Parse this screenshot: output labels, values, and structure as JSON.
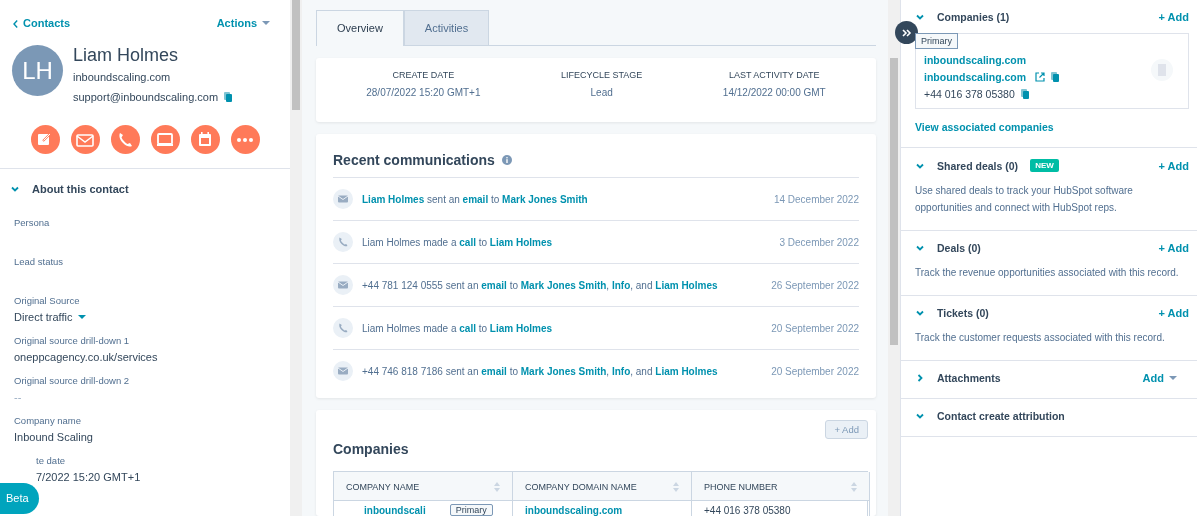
{
  "header": {
    "back_link": "Contacts",
    "actions": "Actions"
  },
  "contact": {
    "initials": "LH",
    "name": "Liam Holmes",
    "domain": "inboundscaling.com",
    "email": "support@inboundscaling.com"
  },
  "quick_actions": [
    {
      "kind": "note"
    },
    {
      "kind": "email"
    },
    {
      "kind": "call"
    },
    {
      "kind": "screen"
    },
    {
      "kind": "calendar"
    },
    {
      "kind": "more"
    }
  ],
  "about": {
    "title": "About this contact",
    "expanded": true
  },
  "fields": [
    {
      "label": "Persona"
    },
    {
      "label": "Lead status"
    },
    {
      "label": "Original Source",
      "value": "Direct traffic",
      "kind": "dropdown"
    },
    {
      "label": "Original source drill-down 1",
      "value": "oneppcagency.co.uk/services",
      "kind": "text"
    },
    {
      "label": "Original source drill-down 2",
      "value": "--",
      "kind": "empty"
    },
    {
      "label": "Company name",
      "value": "Inbound Scaling",
      "kind": "text"
    },
    {
      "label": "te date",
      "value": "7/2022 15:20 GMT+1",
      "kind": "text"
    }
  ],
  "beta_button": "Beta",
  "tabs": [
    {
      "label": "Overview",
      "selected": true
    },
    {
      "label": "Activities",
      "selected": false
    }
  ],
  "summary": [
    {
      "label": "CREATE DATE",
      "value": "28/07/2022 15:20 GMT+1"
    },
    {
      "label": "LIFECYCLE STAGE",
      "value": "Lead"
    },
    {
      "label": "LAST ACTIVITY DATE",
      "value": "14/12/2022 00:00 GMT"
    }
  ],
  "recent": {
    "title": "Recent communications",
    "items": [
      {
        "kind": "email",
        "text": "**Liam Holmes** sent an **email** to **Mark Jones Smith**",
        "date": "14 December 2022"
      },
      {
        "kind": "call",
        "text": "Liam Holmes made a **call** to **Liam Holmes**",
        "date": "3 December 2022"
      },
      {
        "kind": "email",
        "text": "+44 781 124 0555 sent an **email** to **Mark Jones Smith**, **Info**, and **Liam Holmes**",
        "date": "26 September 2022"
      },
      {
        "kind": "call",
        "text": "Liam Holmes made a **call** to **Liam Holmes**",
        "date": "20 September 2022"
      },
      {
        "kind": "email",
        "text": "+44 746 818 7186 sent an **email** to **Mark Jones Smith**, **Info**, and **Liam Holmes**",
        "date": "20 September 2022"
      }
    ]
  },
  "companies": {
    "title": "Companies",
    "add": "+ Add",
    "columns": [
      "COMPANY NAME",
      "COMPANY DOMAIN NAME",
      "PHONE NUMBER"
    ],
    "rows": [
      {
        "name": "inboundscali",
        "badge": "Primary",
        "domain": "inboundscaling.com",
        "phone": "+44 016 378 05380"
      }
    ]
  },
  "sidebar": [
    {
      "title": "Companies (1)",
      "expanded": true,
      "action": {
        "kind": "link",
        "label": "+ Add"
      },
      "card": {
        "badge": "Primary",
        "name": "inboundscaling.com",
        "domain": "inboundscaling.com",
        "phone": "+44 016 378 05380"
      },
      "link": "View associated companies"
    },
    {
      "title": "Shared deals (0)",
      "expanded": true,
      "badge": "NEW",
      "action": {
        "kind": "link",
        "label": "+ Add"
      },
      "description": "Use shared deals to track your HubSpot software opportunities and connect with HubSpot reps."
    },
    {
      "title": "Deals (0)",
      "expanded": true,
      "action": {
        "kind": "link",
        "label": "+ Add"
      },
      "description": "Track the revenue opportunities associated with this record."
    },
    {
      "title": "Tickets (0)",
      "expanded": true,
      "action": {
        "kind": "link",
        "label": "+ Add"
      },
      "description": "Track the customer requests associated with this record."
    },
    {
      "title": "Attachments",
      "expanded": false,
      "action": {
        "kind": "dropdown",
        "label": "Add"
      }
    },
    {
      "title": "Contact create attribution",
      "expanded": true
    }
  ]
}
